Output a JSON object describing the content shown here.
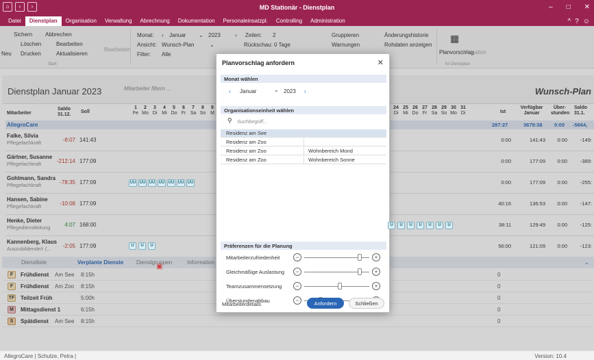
{
  "app": {
    "title": "MD Stationär - Dienstplan"
  },
  "menu": [
    "Datei",
    "Dienstplan",
    "Organisation",
    "Verwaltung",
    "Abrechnung",
    "Dokumentation",
    "Personaleinsatzpl.",
    "Controlling",
    "Administration"
  ],
  "ribbon": {
    "new": "Neu",
    "save": "Sichern",
    "cancel": "Abbrechen",
    "delete": "Löschen",
    "edit": "Bearbeiten",
    "print": "Drucken",
    "refresh": "Aktualisieren",
    "edit_big": "Bearbeiten",
    "start": "Start",
    "month_label": "Monat:",
    "month": "Januar",
    "year": "2023",
    "view_label": "Ansicht:",
    "view": "Wunsch-Plan",
    "filter_label": "Filter:",
    "filter": "Alle",
    "rows_label": "Zeilen:",
    "rows": "2",
    "review_label": "Rückschau:",
    "review": "0 Tage",
    "groups": "Gruppieren",
    "warnings": "Warnungen",
    "history": "Änderungshistorie",
    "raw": "Rohdaten anzeigen",
    "proposal": "Planvorschlag",
    "navigation": "Navigation",
    "ki": "KI-Dienstplan"
  },
  "page": {
    "title": "Dienstplan Januar 2023",
    "filter_placeholder": "Mitarbeiter filtern ...",
    "view_title": "Wunsch-Plan"
  },
  "columns": {
    "employee": "Mitarbeiter",
    "saldo": "Saldo",
    "saldo_date": "31.12.",
    "soll": "Soll",
    "ist": "Ist",
    "verf": "Verfügbar",
    "verf2": "Januar",
    "ueber": "Über-",
    "ueber2": "stunden",
    "saldo_end": "Saldo",
    "saldo_end2": "31.1."
  },
  "days_left": [
    {
      "n": "1",
      "d": "Fe"
    },
    {
      "n": "2",
      "d": "Mo"
    },
    {
      "n": "3",
      "d": "Di"
    },
    {
      "n": "4",
      "d": "Mi"
    },
    {
      "n": "5",
      "d": "Do"
    },
    {
      "n": "6",
      "d": "Fr"
    },
    {
      "n": "7",
      "d": "Sa"
    },
    {
      "n": "8",
      "d": "So"
    },
    {
      "n": "9",
      "d": "M"
    }
  ],
  "days_right": [
    {
      "n": "24",
      "d": "Di"
    },
    {
      "n": "25",
      "d": "Mi"
    },
    {
      "n": "26",
      "d": "Do"
    },
    {
      "n": "27",
      "d": "Fr"
    },
    {
      "n": "28",
      "d": "Sa"
    },
    {
      "n": "29",
      "d": "So"
    },
    {
      "n": "30",
      "d": "Mo"
    },
    {
      "n": "31",
      "d": "Di"
    }
  ],
  "group": {
    "name": "AllegroCare",
    "ist": "287:27",
    "verf": "3679:38",
    "ueber": "0:00",
    "saldo": "-5664,"
  },
  "employees": [
    {
      "name": "Falke, Silvia",
      "role": "Pflegefachkraft",
      "saldo": "-8:07",
      "soll": "141:43",
      "ist": "0:00",
      "verf": "141:43",
      "ueber": "0:00",
      "end": "-149:"
    },
    {
      "name": "Gärtner, Susanne",
      "role": "Pflegefachkraft",
      "saldo": "-212:14",
      "soll": "177:09",
      "ist": "0:00",
      "verf": "177:09",
      "ueber": "0:00",
      "end": "-389:"
    },
    {
      "name": "Gohlmann, Sandra",
      "role": "Pflegefachkraft",
      "saldo": "-78:35",
      "soll": "177:09",
      "ist": "0:00",
      "verf": "177:09",
      "ueber": "0:00",
      "end": "-255:"
    },
    {
      "name": "Hansen, Sabine",
      "role": "Pflegefachkraft",
      "saldo": "-10:08",
      "soll": "177:09",
      "ist": "40:16",
      "verf": "136:53",
      "ueber": "0:00",
      "end": "-147:"
    },
    {
      "name": "Henke, Dieter",
      "role": "Pflegedienstleitung",
      "saldo": "4:07",
      "soll": "168:00",
      "ist": "38:11",
      "verf": "129:49",
      "ueber": "0:00",
      "end": "-125:"
    },
    {
      "name": "Kannenberg, Klaus",
      "role": "Auszubildende/r (...",
      "saldo": "-2:05",
      "soll": "177:09",
      "ist": "56:00",
      "verf": "121:09",
      "ueber": "0:00",
      "end": "-123:"
    }
  ],
  "shift_codes": {
    "uu": "UU",
    "u": "U"
  },
  "tabs": [
    "Dienstliste",
    "Verplante Dienste",
    "Dienstgruppen",
    "Information"
  ],
  "services": [
    {
      "code": "F",
      "name": "Frühdienst",
      "loc": "Am See",
      "dur": "8:15h",
      "z": "0"
    },
    {
      "code": "F",
      "name": "Frühdienst",
      "loc": "Am Zoo",
      "dur": "8:15h",
      "z": "0"
    },
    {
      "code": "TF",
      "name": "Teilzeit Früh",
      "loc": "",
      "dur": "5:00h",
      "z": "0"
    },
    {
      "code": "M",
      "name": "Mittagsdienst 1",
      "loc": "",
      "dur": "6:15h",
      "z": "0"
    },
    {
      "code": "S",
      "name": "Spätdienst",
      "loc": "Am See",
      "dur": "8:15h",
      "z": "0"
    }
  ],
  "status": {
    "left": "AllegroCare | Schulze, Petra |",
    "version": "Version: 10.4"
  },
  "dialog": {
    "title": "Planvorschlag anfordern",
    "month_section": "Monat wählen",
    "month": "Januar",
    "year": "2023",
    "org_section": "Organisationseinheit wählen",
    "search_placeholder": "Suchbegriff...",
    "units": [
      {
        "a": "Residenz am See",
        "b": ""
      },
      {
        "a": "Residenz am Zoo",
        "b": ""
      },
      {
        "a": "Residenz am Zoo",
        "b": "Wohnbereich Mond"
      },
      {
        "a": "Residenz am Zoo",
        "b": "Wohnbereich Sonne"
      }
    ],
    "pref_section": "Präferenzen für die Planung",
    "prefs": [
      {
        "label": "Mitarbeiterzufriedenheit",
        "level": 0.85
      },
      {
        "label": "Gleichmäßige Auslastung",
        "level": 0.85
      },
      {
        "label": "Teamzusammensetzung",
        "level": 0.55
      },
      {
        "label": "Überstundenabbau",
        "level": 0.25
      }
    ],
    "details": "Mitarbeiterdetails",
    "request": "Anfordern",
    "close": "Schließen"
  },
  "colors": {
    "brand": "#9b2352",
    "accent": "#2a66b5"
  }
}
